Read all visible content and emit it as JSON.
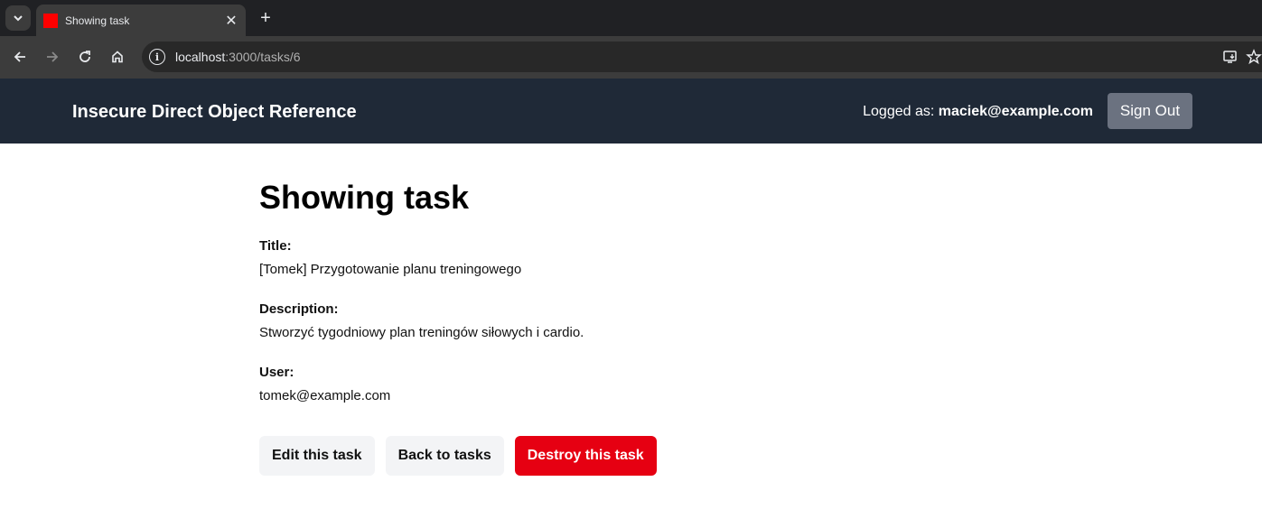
{
  "browser": {
    "tab_title": "Showing task",
    "url_host": "localhost",
    "url_rest": ":3000/tasks/6",
    "new_tab": "+",
    "close": "✕"
  },
  "header": {
    "brand": "Insecure Direct Object Reference",
    "logged_label": "Logged as: ",
    "logged_user": "maciek@example.com",
    "signout": "Sign Out"
  },
  "task": {
    "heading": "Showing task",
    "title_label": "Title:",
    "title_value": "[Tomek] Przygotowanie planu treningowego",
    "description_label": "Description:",
    "description_value": "Stworzyć tygodniowy plan treningów siłowych i cardio.",
    "user_label": "User:",
    "user_value": "tomek@example.com"
  },
  "actions": {
    "edit": "Edit this task",
    "back": "Back to tasks",
    "destroy": "Destroy this task"
  },
  "colors": {
    "header_bg": "#1f2937",
    "signout_bg": "#6b7280",
    "danger": "#e60012",
    "favicon": "#ff0000"
  }
}
